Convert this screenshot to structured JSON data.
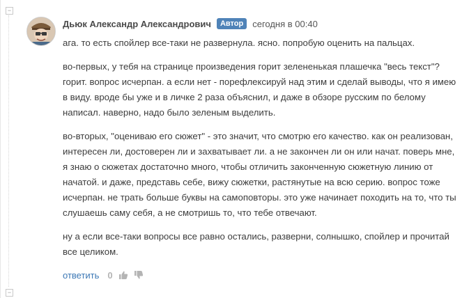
{
  "comment": {
    "author": "Дьюк Александр Александрович",
    "badge": "Автор",
    "timestamp": "сегодня в 00:40",
    "paragraphs": [
      "ага. то есть спойлер все-таки не развернула. ясно. попробую оценить на пальцах.",
      "во-первых, у тебя на странице произведения горит зелененькая плашечка \"весь текст\"? горит. вопрос исчерпан. а если нет - порефлексируй над этим и сделай выводы, что я имею в виду. вроде бы уже и в личке 2 раза объяснил, и даже в обзоре русским по белому написал. наверно, надо было зеленым выделить.",
      "во-вторых, \"оцениваю его сюжет\" - это значит, что смотрю его качество. как он реализован, интересен ли, достоверен ли и захватывает ли. а не закончен ли он или начат. поверь мне, я знаю о сюжетах достаточно много, чтобы отличить законченную сюжетную линию от начатой. и даже, представь себе, вижу сюжетки, растянутые на всю серию. вопрос тоже исчерпан. не трать больше буквы на самоповторы. это уже начинает походить на то, что ты слушаешь саму себя, а не смотришь то, что тебе отвечают.",
      "ну а если все-таки вопросы все равно остались, разверни, солнышко, спойлер и прочитай все целиком."
    ],
    "reply_label": "ответить",
    "rating": "0",
    "thumb_up_icon": "thumb-up-icon",
    "thumb_down_icon": "thumb-down-icon"
  },
  "colors": {
    "badge_bg": "#4f83b8",
    "link": "#3c78b5",
    "rating": "#b4b4b4"
  }
}
